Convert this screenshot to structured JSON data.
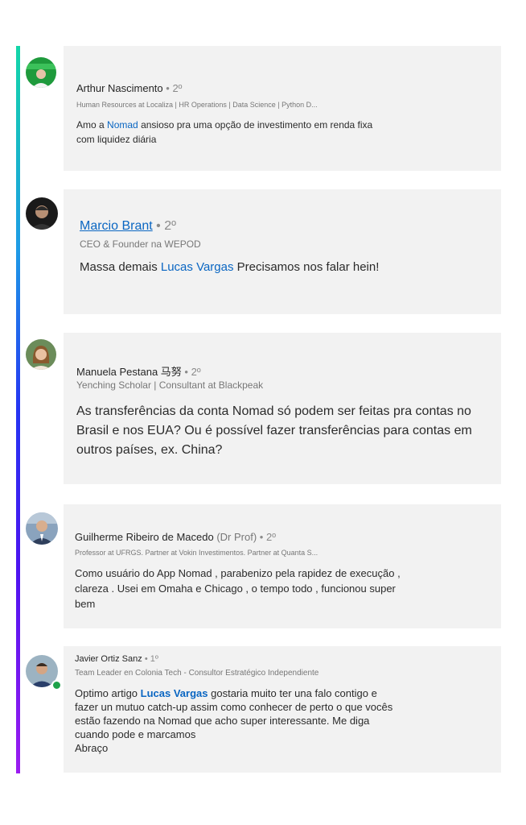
{
  "comments": [
    {
      "author": "Arthur Nascimento",
      "degree": "• 2º",
      "headline": "Human Resources at Localiza | HR Operations | Data Science | Python D...",
      "body_before": "Amo a",
      "mention": "Nomad",
      "body_after_1": "ansioso pra uma opção de investimento em renda fixa",
      "body_after_2": "com liquidez diária",
      "avatar_icon": "avatar-arthur-icon"
    },
    {
      "author": "Marcio Brant",
      "degree": "• 2º",
      "headline": "CEO & Founder na WEPOD",
      "body_before": "Massa demais",
      "mention": "Lucas Vargas",
      "body_after": "Precisamos nos falar hein!",
      "avatar_icon": "avatar-marcio-icon"
    },
    {
      "author": "Manuela Pestana 马努",
      "degree": "• 2º",
      "headline": "Yenching Scholar | Consultant at Blackpeak",
      "body_lines": [
        "As transferências da conta Nomad só podem ser feitas pra contas no",
        "Brasil e nos EUA? Ou é possível fazer transferências para contas em",
        "outros países, ex. China?"
      ],
      "avatar_icon": "avatar-manuela-icon"
    },
    {
      "author": "Guilherme Ribeiro de Macedo",
      "suffix": "(Dr Prof)",
      "degree": "• 2º",
      "headline": "Professor at UFRGS. Partner at Vokin Investimentos. Partner at Quanta S...",
      "body_lines": [
        "Como usuário do App Nomad , parabenizo pela rapidez de execução ,",
        "clareza . Usei em Omaha e Chicago , o tempo todo , funcionou super",
        "bem"
      ],
      "avatar_icon": "avatar-guilherme-icon"
    },
    {
      "author": "Javier Ortiz Sanz",
      "degree": "• 1º",
      "headline": "Team Leader en Colonia Tech - Consultor Estratégico Independiente",
      "body_before": "Optimo artigo",
      "mention": "Lucas Vargas",
      "body_after_1": "gostaria muito ter una falo contigo e",
      "body_lines": [
        "fazer un mutuo catch-up assim como conhecer de perto o que vocês",
        "estão fazendo na Nomad que acho super interessante. Me diga",
        "cuando pode e marcamos",
        "Abraço"
      ],
      "avatar_icon": "avatar-javier-icon"
    }
  ],
  "colors": {
    "card_bg": "#f2f2f2",
    "mention": "#0a66c2",
    "gradient_top": "#13d6a8",
    "gradient_bottom": "#9b1cf0"
  }
}
